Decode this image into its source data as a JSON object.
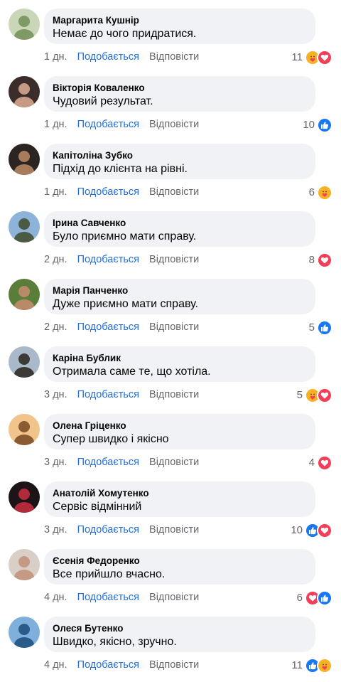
{
  "actions": {
    "like_label": "Подобається",
    "reply_label": "Відповісти"
  },
  "colors": {
    "link": "#216fdb",
    "muted": "#65676b",
    "bubble": "#f0f2f5",
    "like": "#1877f2",
    "love": "#f33e58",
    "care": "#f7b125"
  },
  "comments": [
    {
      "author": "Маргарита Кушнір",
      "text": "Немає до чого придратися.",
      "time": "1 дн.",
      "reaction_count": "11",
      "reactions": [
        "care-reaction-icon",
        "love-reaction-icon"
      ],
      "avatar": [
        "#c9d7b8",
        "#7f9a64"
      ]
    },
    {
      "author": "Вікторія Коваленко",
      "text": "Чудовий результат.",
      "time": "1 дн.",
      "reaction_count": "10",
      "reactions": [
        "like-reaction-icon"
      ],
      "avatar": [
        "#3b2e2a",
        "#c79a86"
      ]
    },
    {
      "author": "Капітоліна Зубко",
      "text": "Підхід до клієнта на рівні.",
      "time": "1 дн.",
      "reaction_count": "6",
      "reactions": [
        "care-reaction-icon"
      ],
      "avatar": [
        "#2b2420",
        "#a67c5c"
      ]
    },
    {
      "author": "Ірина Савченко",
      "text": "Було приємно мати справу.",
      "time": "2 дн.",
      "reaction_count": "8",
      "reactions": [
        "love-reaction-icon"
      ],
      "avatar": [
        "#8db3d8",
        "#4a5a44"
      ]
    },
    {
      "author": "Марія Панченко",
      "text": "Дуже приємно мати справу.",
      "time": "2 дн.",
      "reaction_count": "5",
      "reactions": [
        "like-reaction-icon"
      ],
      "avatar": [
        "#5b7d3a",
        "#b98a6a"
      ]
    },
    {
      "author": "Каріна Бублик",
      "text": "Отримала саме те, що хотіла.",
      "time": "3 дн.",
      "reaction_count": "5",
      "reactions": [
        "care-reaction-icon",
        "love-reaction-icon"
      ],
      "avatar": [
        "#a9b9c9",
        "#3c3a36"
      ]
    },
    {
      "author": "Олена Гріценко",
      "text": "Супер швидко і якісно",
      "time": "3 дн.",
      "reaction_count": "4",
      "reactions": [
        "love-reaction-icon"
      ],
      "avatar": [
        "#f0c48a",
        "#8a5a30"
      ]
    },
    {
      "author": "Анатолій Хомутенко",
      "text": "Сервіс відмінний",
      "time": "3 дн.",
      "reaction_count": "10",
      "reactions": [
        "like-reaction-icon",
        "love-reaction-icon"
      ],
      "avatar": [
        "#1c1416",
        "#b02a3a"
      ]
    },
    {
      "author": "Єсенія Федоренко",
      "text": "Все прийшло вчасно.",
      "time": "4 дн.",
      "reaction_count": "6",
      "reactions": [
        "love-reaction-icon",
        "like-reaction-icon"
      ],
      "avatar": [
        "#d9cfc6",
        "#c49a84"
      ]
    },
    {
      "author": "Олеся Бутенко",
      "text": "Швидко, якісно, зручно.",
      "time": "4 дн.",
      "reaction_count": "11",
      "reactions": [
        "like-reaction-icon",
        "care-reaction-icon"
      ],
      "avatar": [
        "#7fb0dc",
        "#2a5c8a"
      ]
    }
  ]
}
